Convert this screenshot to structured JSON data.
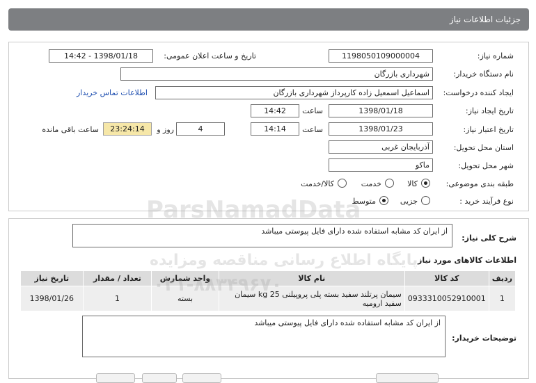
{
  "header": {
    "title": "جزئیات اطلاعات نیاز"
  },
  "form": {
    "need_number_label": "شماره نیاز:",
    "need_number": "1198050109000004",
    "announce_label": "تاریخ و ساعت اعلان عمومی:",
    "announce_value": "1398/01/18 - 14:42",
    "buyer_org_label": "نام دستگاه خریدار:",
    "buyer_org": "شهرداری بازرگان",
    "creator_label": "ایجاد کننده درخواست:",
    "creator": "اسماعیل اسمعیل زاده کارپرداز شهرداری بازرگان",
    "contact_link": "اطلاعات تماس خریدار",
    "create_date_label": "تاریخ ایجاد نیاز:",
    "create_date": "1398/01/18",
    "time_label": "ساعت",
    "create_time": "14:42",
    "validity_label": "تاریخ اعتبار نیاز:",
    "validity_date": "1398/01/23",
    "validity_time": "14:14",
    "days_value": "4",
    "days_label": "روز و",
    "remaining_time": "23:24:14",
    "remaining_label": "ساعت باقی مانده",
    "province_label": "استان محل تحویل:",
    "province": "آذربایجان غربی",
    "city_label": "شهر محل تحویل:",
    "city": "ماکو",
    "category_label": "طبقه بندی موضوعی:",
    "category_options": [
      "کالا",
      "خدمت",
      "کالا/خدمت"
    ],
    "process_label": "نوع فرآیند خرید :",
    "process_options": [
      "جزیی",
      "متوسط"
    ]
  },
  "summary": {
    "label": "شرح کلی نیاز:",
    "text": "از ایران کد مشابه استفاده شده دارای فایل پیوستی میباشد"
  },
  "goods": {
    "title": "اطلاعات کالاهای مورد نیاز",
    "columns": [
      "ردیف",
      "کد کالا",
      "نام کالا",
      "واحد شمارش",
      "تعداد / مقدار",
      "تاریخ نیاز"
    ],
    "rows": [
      {
        "row": "1",
        "code": "0933310052910001",
        "name": "سیمان پرتلند سفید بسته پلی پروپیلنی 25 kg سیمان سفید ارومیه",
        "unit": "بسته",
        "qty": "1",
        "date": "1398/01/26"
      }
    ]
  },
  "buyer_notes": {
    "label": "توضیحات خریدار:",
    "text": "از ایران کد مشابه استفاده شده دارای فایل پیوستی میباشد"
  },
  "watermark": {
    "line1": "ParsNamadData",
    "line2": "پایگاه اطلاع رسانی مناقصه ومزایده",
    "line3": "۰۲۱-۸۸۳۴۹۶۷۰"
  }
}
